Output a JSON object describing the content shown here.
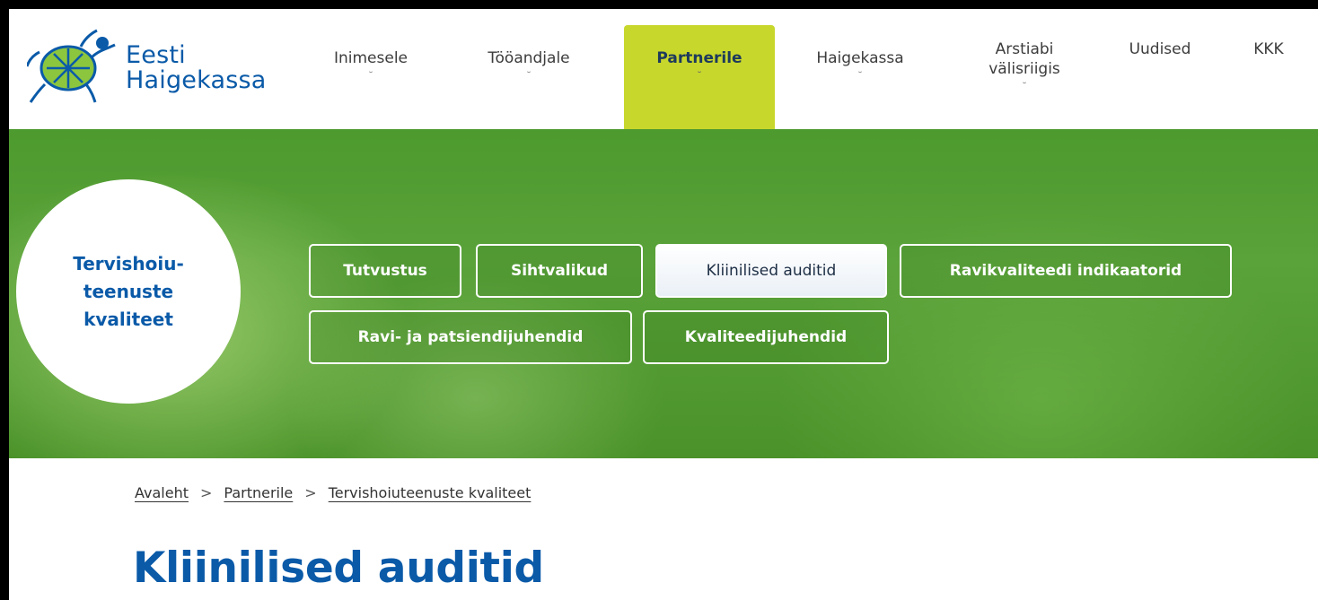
{
  "brand": {
    "line1": "Eesti",
    "line2": "Haigekassa",
    "color": "#0a5aa8",
    "accent": "#c8d72c"
  },
  "nav": [
    {
      "label": "Inimesele",
      "chevron": "˘"
    },
    {
      "label": "Tööandjale",
      "chevron": "˘"
    },
    {
      "label": "Partnerile",
      "chevron": "˘",
      "active": true
    },
    {
      "label": "Haigekassa",
      "chevron": "˘"
    },
    {
      "label": "Arstiabi\nvälisriigis",
      "chevron": "˘"
    },
    {
      "label": "Uudised"
    },
    {
      "label": "KKK"
    }
  ],
  "hero": {
    "section_title": "Tervishoiu-\nteenuste\nkvaliteet",
    "tabs": [
      {
        "label": "Tutvustus"
      },
      {
        "label": "Sihtvalikud"
      },
      {
        "label": "Kliinilised auditid",
        "active": true
      },
      {
        "label": "Ravikvaliteedi indikaatorid"
      },
      {
        "label": "Ravi- ja patsiendijuhendid"
      },
      {
        "label": "Kvaliteedijuhendid"
      }
    ]
  },
  "breadcrumb": [
    {
      "label": "Avaleht"
    },
    {
      "label": "Partnerile"
    },
    {
      "label": "Tervishoiuteenuste kvaliteet"
    }
  ],
  "breadcrumb_separator": ">",
  "page_title": "Kliinilised auditid"
}
